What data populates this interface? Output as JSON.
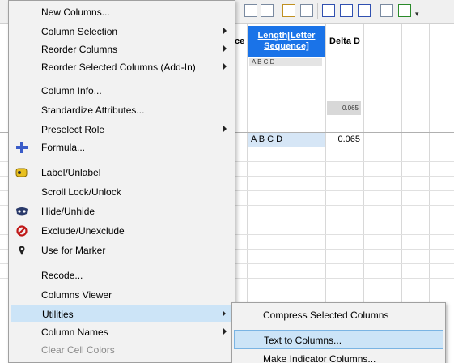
{
  "grid": {
    "columns": [
      {
        "name": "Length[Letter Sequence]",
        "line1": "Length[Letter",
        "line2": "Sequence]",
        "preview": "A B C D"
      },
      {
        "name": "Delta D",
        "preview": "0.065"
      }
    ],
    "truncated_header": "ce",
    "row1": {
      "length_value": "A B C D",
      "delta_value": "0.065"
    }
  },
  "menu": {
    "items": [
      {
        "label": "New Columns...",
        "submenu": false
      },
      {
        "label": "Column Selection",
        "submenu": true
      },
      {
        "label": "Reorder Columns",
        "submenu": true
      },
      {
        "label": "Reorder Selected Columns (Add-In)",
        "submenu": true
      },
      {
        "label": "Column Info...",
        "submenu": false
      },
      {
        "label": "Standardize Attributes...",
        "submenu": false
      },
      {
        "label": "Preselect Role",
        "submenu": true
      },
      {
        "label": "Formula...",
        "submenu": false,
        "icon": "plus-icon"
      },
      {
        "label": "Label/Unlabel",
        "submenu": false,
        "icon": "label-tag-icon"
      },
      {
        "label": "Scroll Lock/Unlock",
        "submenu": false
      },
      {
        "label": "Hide/Unhide",
        "submenu": false,
        "icon": "hide-mask-icon"
      },
      {
        "label": "Exclude/Unexclude",
        "submenu": false,
        "icon": "exclude-icon"
      },
      {
        "label": "Use for Marker",
        "submenu": false,
        "icon": "marker-pin-icon"
      },
      {
        "label": "Recode...",
        "submenu": false
      },
      {
        "label": "Columns Viewer",
        "submenu": false
      },
      {
        "label": "Utilities",
        "submenu": true,
        "highlighted": true
      },
      {
        "label": "Column Names",
        "submenu": true
      },
      {
        "label": "Clear Cell Colors",
        "submenu": false,
        "disabled": true
      }
    ]
  },
  "submenu": {
    "items": [
      {
        "label": "Compress Selected Columns"
      },
      {
        "label": "Text to Columns...",
        "highlighted": true
      },
      {
        "label": "Make Indicator Columns..."
      }
    ]
  },
  "colors": {
    "selected_header": "#1a73e8",
    "menu_bg": "#f2f2f2",
    "hover_bg": "#cce4f7",
    "hover_border": "#7ab4e3"
  }
}
